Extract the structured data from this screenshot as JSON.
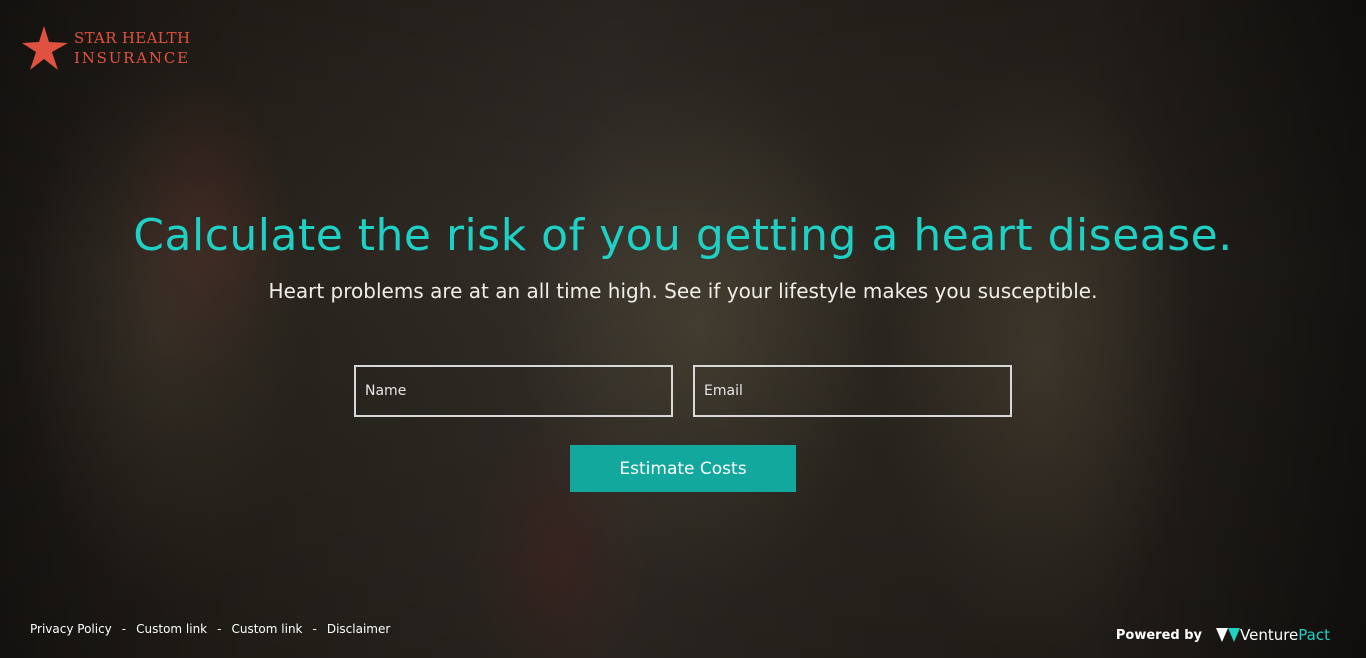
{
  "brand": {
    "name_line1": "STAR HEALTH",
    "name_line2": "INSURANCE",
    "logo_icon": "star-icon",
    "color": "#e0523f"
  },
  "hero": {
    "headline": "Calculate the risk of you getting a heart disease.",
    "subheadline": "Heart problems are at an all time high. See if your lifestyle makes you susceptible."
  },
  "form": {
    "name_placeholder": "Name",
    "email_placeholder": "Email",
    "submit_label": "Estimate Costs"
  },
  "footer": {
    "links": [
      "Privacy Policy",
      "Custom link",
      "Custom link",
      "Disclaimer"
    ],
    "separator": "-",
    "powered_by_label": "Powered by",
    "powered_by_brand_part1": "Venture",
    "powered_by_brand_part2": "Pact",
    "powered_by_icon": "venturepact-logo-icon"
  },
  "colors": {
    "accent": "#1fd1c4",
    "button": "#13a89e",
    "brand_red": "#e0523f"
  }
}
